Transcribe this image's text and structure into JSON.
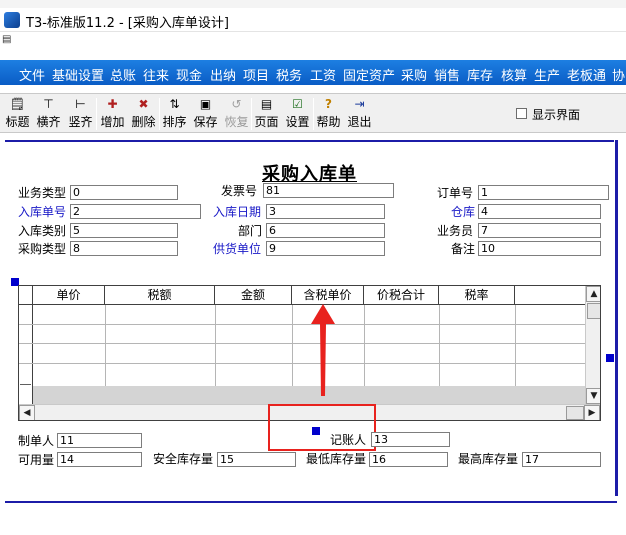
{
  "window": {
    "title": "T3-标准版11.2 - [采购入库单设计]"
  },
  "menu": [
    "文件",
    "基础设置",
    "总账",
    "往来",
    "现金",
    "出纳",
    "项目",
    "税务",
    "工资",
    "固定资产",
    "采购",
    "销售",
    "库存",
    "核算",
    "生产",
    "老板通",
    "协"
  ],
  "toolbar": {
    "buttons": [
      {
        "label": "标题",
        "icon": "title-icon"
      },
      {
        "label": "横齐",
        "icon": "align-horizontal-icon"
      },
      {
        "label": "竖齐",
        "icon": "align-vertical-icon"
      },
      {
        "label": "增加",
        "icon": "add-icon"
      },
      {
        "label": "删除",
        "icon": "delete-icon"
      },
      {
        "label": "排序",
        "icon": "sort-icon"
      },
      {
        "label": "保存",
        "icon": "save-icon"
      },
      {
        "label": "恢复",
        "icon": "restore-icon",
        "disabled": true
      },
      {
        "label": "页面",
        "icon": "page-icon"
      },
      {
        "label": "设置",
        "icon": "settings-icon"
      },
      {
        "label": "帮助",
        "icon": "help-icon"
      },
      {
        "label": "退出",
        "icon": "exit-icon"
      }
    ],
    "show_ui_label": "显示界面",
    "show_ui_checked": false
  },
  "form": {
    "title": "采购入库单",
    "fields": {
      "ywlx": {
        "label": "业务类型",
        "value": "0"
      },
      "fph": {
        "label": "发票号",
        "value": "81"
      },
      "ddh": {
        "label": "订单号",
        "value": "1"
      },
      "rkdh": {
        "label": "入库单号",
        "value": "2"
      },
      "rkrq": {
        "label": "入库日期",
        "value": "3"
      },
      "ck": {
        "label": "仓库",
        "value": "4"
      },
      "rklb": {
        "label": "入库类别",
        "value": "5"
      },
      "bm": {
        "label": "部门",
        "value": "6"
      },
      "ywy": {
        "label": "业务员",
        "value": "7"
      },
      "cglx": {
        "label": "采购类型",
        "value": "8"
      },
      "ghdw": {
        "label": "供货单位",
        "value": "9"
      },
      "bz": {
        "label": "备注",
        "value": "10"
      }
    },
    "grid": {
      "columns": [
        "单价",
        "税额",
        "金额",
        "含税单价",
        "价税合计",
        "税率"
      ]
    },
    "footer": {
      "zdr": {
        "label": "制单人",
        "value": "11"
      },
      "jzr": {
        "label": "记账人",
        "value": "13"
      },
      "kyl": {
        "label": "可用量",
        "value": "14"
      },
      "aqkcl": {
        "label": "安全库存量",
        "value": "15"
      },
      "zdkcl": {
        "label": "最低库存量",
        "value": "16"
      },
      "zgkcl": {
        "label": "最高库存量",
        "value": "17"
      }
    }
  },
  "colors": {
    "menubar": "#0a5cc5",
    "label_blue": "#1919c7",
    "annotation_red": "#e8221e",
    "handle_blue": "#0000cc"
  }
}
